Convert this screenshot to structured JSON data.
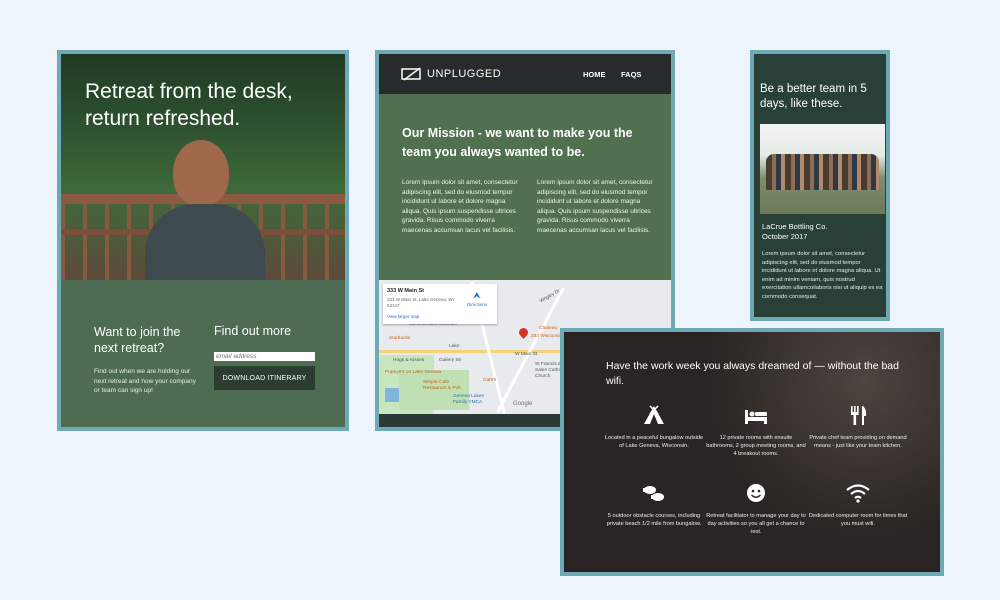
{
  "card_hero": {
    "headline": "Retreat from the desk, return refreshed.",
    "join_title": "Want to join the next retreat?",
    "join_body": "Find out when we are holding our next retreat and how your company or team can sign up!",
    "find_title": "Find out more",
    "email_placeholder": "email address",
    "download_button": "DOWNLOAD ITINERARY"
  },
  "card_mission": {
    "brand": "UNPLUGGED",
    "nav": [
      "HOME",
      "FAQS"
    ],
    "mission_title": "Our Mission - we want to make you the team you always wanted to be.",
    "col1": "Lorem ipsum dolor sit amet, consectetur adipiscing elit, sed do eiusmod tempor incididunt ut labore et dolore magna aliqua. Quis ipsum suspendisse ultrices gravida. Risus commodo viverra maecenas accumsan lacus vel facilisis.",
    "col2": "Lorem ipsum dolor sit amet, consectetur adipiscing elit, sed do eiusmod tempor incididunt ut labore et dolore magna aliqua. Quis ipsum suspendisse ultrices gravida. Risus commodo viverra maecenas accumsan lacus vel facilisis.",
    "map": {
      "address": "333 W Main St",
      "address_detail": "333 W Main St, Lake Geneva, WI 53147",
      "directions": "Directions",
      "larger_map": "View larger map",
      "labels": [
        "Geneva Lake Museum",
        "Starbucks",
        "Chateau",
        "333 Wisconsin",
        "Hogs & Kisses",
        "Gallery 56",
        "W Main St",
        "Popeye's on Lake Geneva",
        "Simple Cafe Restaurant & Pub",
        "Cafe's",
        "St Francis de Sales Catholic Church",
        "Geneva Lakes Family YMCA",
        "Lake",
        "Wrigley Dr"
      ],
      "google": "Google"
    }
  },
  "card_team": {
    "title": "Be a better team in 5 days, like these.",
    "company": "LaCrue Bottling Co.",
    "date": "October 2017",
    "body": "Lorem ipsum dolor sit amet, consectetur adipiscing elit, sed do eiusmod tempor incididunt ut labore et dolore magna aliqua. Ut enim ad minim veniam, quis nostrud exercitation ullamcoilaboris nisi ut aliquip ex ea commodo consequat."
  },
  "card_features": {
    "headline": "Have the work week you always dreamed of — without the bad wifi.",
    "features": [
      {
        "icon": "tent-icon",
        "text": "Located in a peaceful bungalow outside of Lake Geneva, Wisconsin."
      },
      {
        "icon": "bed-icon",
        "text": "12 private rooms with ensuite bathrooms, 2 group meeting rooms, and 4 breakout rooms."
      },
      {
        "icon": "utensils-icon",
        "text": "Private chef team providing on demand means - just like your team kitchen."
      },
      {
        "icon": "footprints-icon",
        "text": "5 outdoor obstacle courses, including private beach 1/2 mile from bungalow."
      },
      {
        "icon": "smile-icon",
        "text": "Retreat facilitator to manage your day to day activities so you all get a chance to rest."
      },
      {
        "icon": "wifi-icon",
        "text": "Dedicated computer room for times that you must wifi."
      }
    ]
  }
}
